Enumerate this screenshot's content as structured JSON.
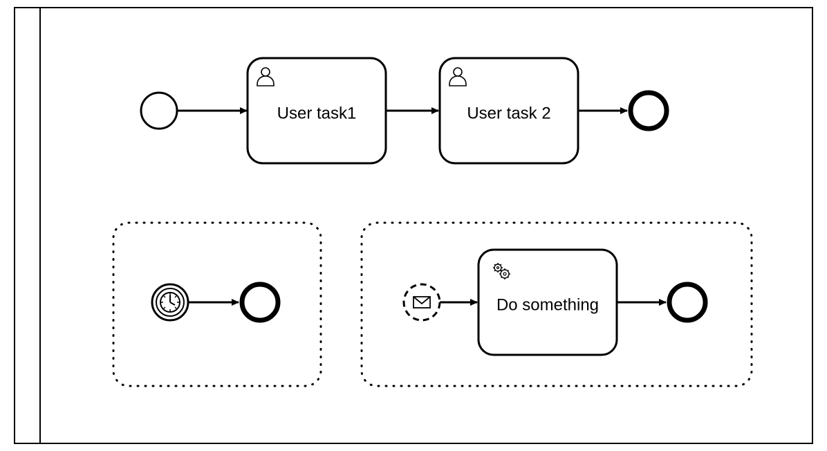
{
  "tasks": {
    "user_task_1": "User task1",
    "user_task_2": "User task 2",
    "service_task": "Do something"
  }
}
